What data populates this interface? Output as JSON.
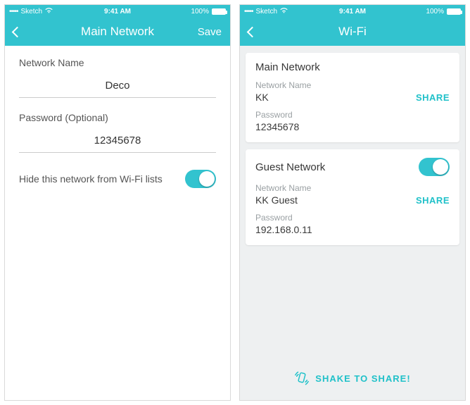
{
  "statusbar": {
    "carrier": "Sketch",
    "time": "9:41 AM",
    "battery": "100%"
  },
  "left": {
    "title": "Main Network",
    "save": "Save",
    "network_name_label": "Network Name",
    "network_name_value": "Deco",
    "password_label": "Password (Optional)",
    "password_value": "12345678",
    "hide_label": "Hide this network from Wi-Fi lists",
    "hide_toggle_on": true
  },
  "right": {
    "title": "Wi-Fi",
    "cards": [
      {
        "title": "Main Network",
        "name_label": "Network Name",
        "name_value": "KK",
        "pwd_label": "Password",
        "pwd_value": "12345678",
        "share": "SHARE",
        "toggle": false
      },
      {
        "title": "Guest Network",
        "name_label": "Network Name",
        "name_value": "KK Guest",
        "pwd_label": "Password",
        "pwd_value": "192.168.0.11",
        "share": "SHARE",
        "toggle": true
      }
    ],
    "shake": "SHAKE TO SHARE!"
  }
}
